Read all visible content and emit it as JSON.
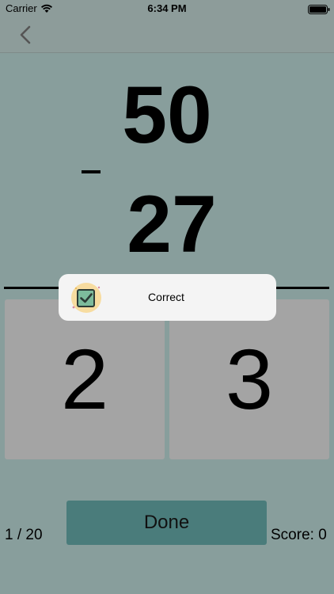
{
  "status_bar": {
    "carrier": "Carrier",
    "time": "6:34 PM"
  },
  "nav": {
    "back_icon": "chevron-left-icon"
  },
  "problem": {
    "top_operand": "50",
    "operator": "-",
    "bottom_operand": "27"
  },
  "answer_digits": [
    {
      "value": "2"
    },
    {
      "value": "3"
    }
  ],
  "toast": {
    "icon": "checkbox-check-icon",
    "message": "Correct"
  },
  "footer": {
    "progress": "1 / 20",
    "done_label": "Done",
    "score": "Score: 0"
  },
  "colors": {
    "background": "#889e9c",
    "answer_box": "#a4a4a4",
    "done_button": "#4a7c7b",
    "toast_bg": "#f4f4f4"
  }
}
